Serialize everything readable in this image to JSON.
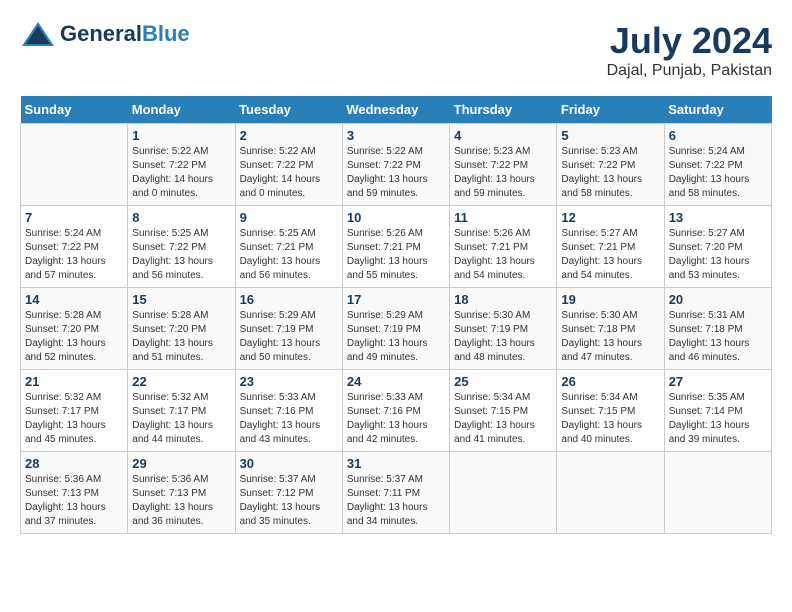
{
  "logo": {
    "text_general": "General",
    "text_blue": "Blue"
  },
  "header": {
    "month_year": "July 2024",
    "location": "Dajal, Punjab, Pakistan"
  },
  "weekdays": [
    "Sunday",
    "Monday",
    "Tuesday",
    "Wednesday",
    "Thursday",
    "Friday",
    "Saturday"
  ],
  "weeks": [
    [
      {
        "num": "",
        "info": ""
      },
      {
        "num": "1",
        "info": "Sunrise: 5:22 AM\nSunset: 7:22 PM\nDaylight: 14 hours\nand 0 minutes."
      },
      {
        "num": "2",
        "info": "Sunrise: 5:22 AM\nSunset: 7:22 PM\nDaylight: 14 hours\nand 0 minutes."
      },
      {
        "num": "3",
        "info": "Sunrise: 5:22 AM\nSunset: 7:22 PM\nDaylight: 13 hours\nand 59 minutes."
      },
      {
        "num": "4",
        "info": "Sunrise: 5:23 AM\nSunset: 7:22 PM\nDaylight: 13 hours\nand 59 minutes."
      },
      {
        "num": "5",
        "info": "Sunrise: 5:23 AM\nSunset: 7:22 PM\nDaylight: 13 hours\nand 58 minutes."
      },
      {
        "num": "6",
        "info": "Sunrise: 5:24 AM\nSunset: 7:22 PM\nDaylight: 13 hours\nand 58 minutes."
      }
    ],
    [
      {
        "num": "7",
        "info": "Sunrise: 5:24 AM\nSunset: 7:22 PM\nDaylight: 13 hours\nand 57 minutes."
      },
      {
        "num": "8",
        "info": "Sunrise: 5:25 AM\nSunset: 7:22 PM\nDaylight: 13 hours\nand 56 minutes."
      },
      {
        "num": "9",
        "info": "Sunrise: 5:25 AM\nSunset: 7:21 PM\nDaylight: 13 hours\nand 56 minutes."
      },
      {
        "num": "10",
        "info": "Sunrise: 5:26 AM\nSunset: 7:21 PM\nDaylight: 13 hours\nand 55 minutes."
      },
      {
        "num": "11",
        "info": "Sunrise: 5:26 AM\nSunset: 7:21 PM\nDaylight: 13 hours\nand 54 minutes."
      },
      {
        "num": "12",
        "info": "Sunrise: 5:27 AM\nSunset: 7:21 PM\nDaylight: 13 hours\nand 54 minutes."
      },
      {
        "num": "13",
        "info": "Sunrise: 5:27 AM\nSunset: 7:20 PM\nDaylight: 13 hours\nand 53 minutes."
      }
    ],
    [
      {
        "num": "14",
        "info": "Sunrise: 5:28 AM\nSunset: 7:20 PM\nDaylight: 13 hours\nand 52 minutes."
      },
      {
        "num": "15",
        "info": "Sunrise: 5:28 AM\nSunset: 7:20 PM\nDaylight: 13 hours\nand 51 minutes."
      },
      {
        "num": "16",
        "info": "Sunrise: 5:29 AM\nSunset: 7:19 PM\nDaylight: 13 hours\nand 50 minutes."
      },
      {
        "num": "17",
        "info": "Sunrise: 5:29 AM\nSunset: 7:19 PM\nDaylight: 13 hours\nand 49 minutes."
      },
      {
        "num": "18",
        "info": "Sunrise: 5:30 AM\nSunset: 7:19 PM\nDaylight: 13 hours\nand 48 minutes."
      },
      {
        "num": "19",
        "info": "Sunrise: 5:30 AM\nSunset: 7:18 PM\nDaylight: 13 hours\nand 47 minutes."
      },
      {
        "num": "20",
        "info": "Sunrise: 5:31 AM\nSunset: 7:18 PM\nDaylight: 13 hours\nand 46 minutes."
      }
    ],
    [
      {
        "num": "21",
        "info": "Sunrise: 5:32 AM\nSunset: 7:17 PM\nDaylight: 13 hours\nand 45 minutes."
      },
      {
        "num": "22",
        "info": "Sunrise: 5:32 AM\nSunset: 7:17 PM\nDaylight: 13 hours\nand 44 minutes."
      },
      {
        "num": "23",
        "info": "Sunrise: 5:33 AM\nSunset: 7:16 PM\nDaylight: 13 hours\nand 43 minutes."
      },
      {
        "num": "24",
        "info": "Sunrise: 5:33 AM\nSunset: 7:16 PM\nDaylight: 13 hours\nand 42 minutes."
      },
      {
        "num": "25",
        "info": "Sunrise: 5:34 AM\nSunset: 7:15 PM\nDaylight: 13 hours\nand 41 minutes."
      },
      {
        "num": "26",
        "info": "Sunrise: 5:34 AM\nSunset: 7:15 PM\nDaylight: 13 hours\nand 40 minutes."
      },
      {
        "num": "27",
        "info": "Sunrise: 5:35 AM\nSunset: 7:14 PM\nDaylight: 13 hours\nand 39 minutes."
      }
    ],
    [
      {
        "num": "28",
        "info": "Sunrise: 5:36 AM\nSunset: 7:13 PM\nDaylight: 13 hours\nand 37 minutes."
      },
      {
        "num": "29",
        "info": "Sunrise: 5:36 AM\nSunset: 7:13 PM\nDaylight: 13 hours\nand 36 minutes."
      },
      {
        "num": "30",
        "info": "Sunrise: 5:37 AM\nSunset: 7:12 PM\nDaylight: 13 hours\nand 35 minutes."
      },
      {
        "num": "31",
        "info": "Sunrise: 5:37 AM\nSunset: 7:11 PM\nDaylight: 13 hours\nand 34 minutes."
      },
      {
        "num": "",
        "info": ""
      },
      {
        "num": "",
        "info": ""
      },
      {
        "num": "",
        "info": ""
      }
    ]
  ]
}
